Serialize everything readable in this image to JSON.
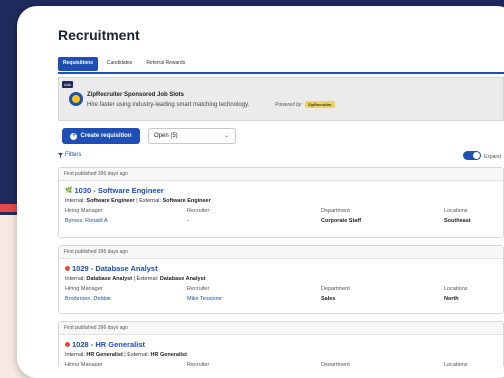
{
  "page": {
    "title": "Recruitment",
    "tabs": [
      "Requisitions",
      "Candidates",
      "Referral Rewards"
    ]
  },
  "banner": {
    "badge": "Ads",
    "title": "ZipRecruiter Sponsored Job Slots",
    "subtitle": "Hire faster using industry-leading smart matching technology.",
    "powered_by": "Powered by",
    "brand": "ZipRecruiter"
  },
  "toolbar": {
    "create_label": "Create requisition",
    "filter_value": "Open (5)",
    "filters_label": "Filters",
    "expand_label": "Expand"
  },
  "columns": {
    "manager": "Hiring Manager",
    "recruiter": "Recruiter",
    "department": "Department",
    "locations": "Locations"
  },
  "requisitions": [
    {
      "published": "First published 396 days ago",
      "title": "1030 - Software Engineer",
      "status_color": "#1fa84f",
      "internal_label": "Internal:",
      "internal": "Software Engineer",
      "external_label": "External:",
      "external": "Software Engineer",
      "manager": "Byrnes, Ronald A",
      "recruiter": "-",
      "department": "Corporate Staff",
      "location": "Southeast"
    },
    {
      "published": "First published 396 days ago",
      "title": "1029 - Database Analyst",
      "status_color": "#e04a3a",
      "internal_label": "Internal:",
      "internal": "Database Analyst",
      "external_label": "External:",
      "external": "Database Analyst",
      "manager": "Brodersen, Debbie",
      "recruiter": "Mike Tessione",
      "department": "Sales",
      "location": "North"
    },
    {
      "published": "First published 396 days ago",
      "title": "1028 - HR Generalist",
      "status_color": "#e04a3a",
      "internal_label": "Internal:",
      "internal": "HR Generalist",
      "external_label": "External:",
      "external": "HR Generalist"
    }
  ]
}
